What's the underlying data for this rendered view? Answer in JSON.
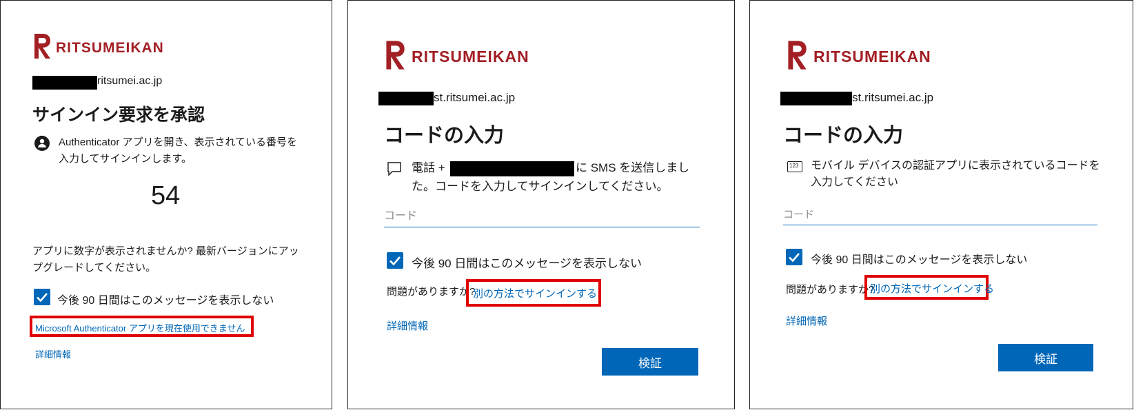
{
  "brand": {
    "logo_text": "RITSUMEIKAN",
    "color": "#a21f24"
  },
  "accent_color": "#0067b8",
  "panel1": {
    "email_suffix": "ritsumei.ac.jp",
    "title": "サインイン要求を承認",
    "message": "Authenticator アプリを開き、表示されている番号を入力してサインインします。",
    "icon": "authenticator-lock-icon",
    "number": "54",
    "upgrade_text": "アプリに数字が表示されませんか? 最新バージョンにアップグレードしてください。",
    "remember_label": "今後 90 日間はこのメッセージを表示しない",
    "cannot_use_link": "Microsoft Authenticator アプリを現在使用できません",
    "more_info_link": "詳細情報"
  },
  "panel2": {
    "email_suffix": "st.ritsumei.ac.jp",
    "title": "コードの入力",
    "icon": "sms-message-icon",
    "message_prefix": "電話 +",
    "message_suffix": "に SMS を送信しました。コードを入力してサインインしてください。",
    "code_placeholder": "コード",
    "remember_label": "今後 90 日間はこのメッセージを表示しない",
    "trouble_text": "問題がありますか?",
    "other_method_link": "別の方法でサインインする",
    "more_info_link": "詳細情報",
    "verify_button": "検証"
  },
  "panel3": {
    "email_suffix": "st.ritsumei.ac.jp",
    "title": "コードの入力",
    "icon": "numeric-code-icon",
    "icon_text": "123",
    "message": "モバイル デバイスの認証アプリに表示されているコードを入力してください",
    "code_placeholder": "コード",
    "remember_label": "今後 90 日間はこのメッセージを表示しない",
    "trouble_text": "問題がありますか?",
    "other_method_link": "別の方法でサインインする",
    "more_info_link": "詳細情報",
    "verify_button": "検証"
  }
}
